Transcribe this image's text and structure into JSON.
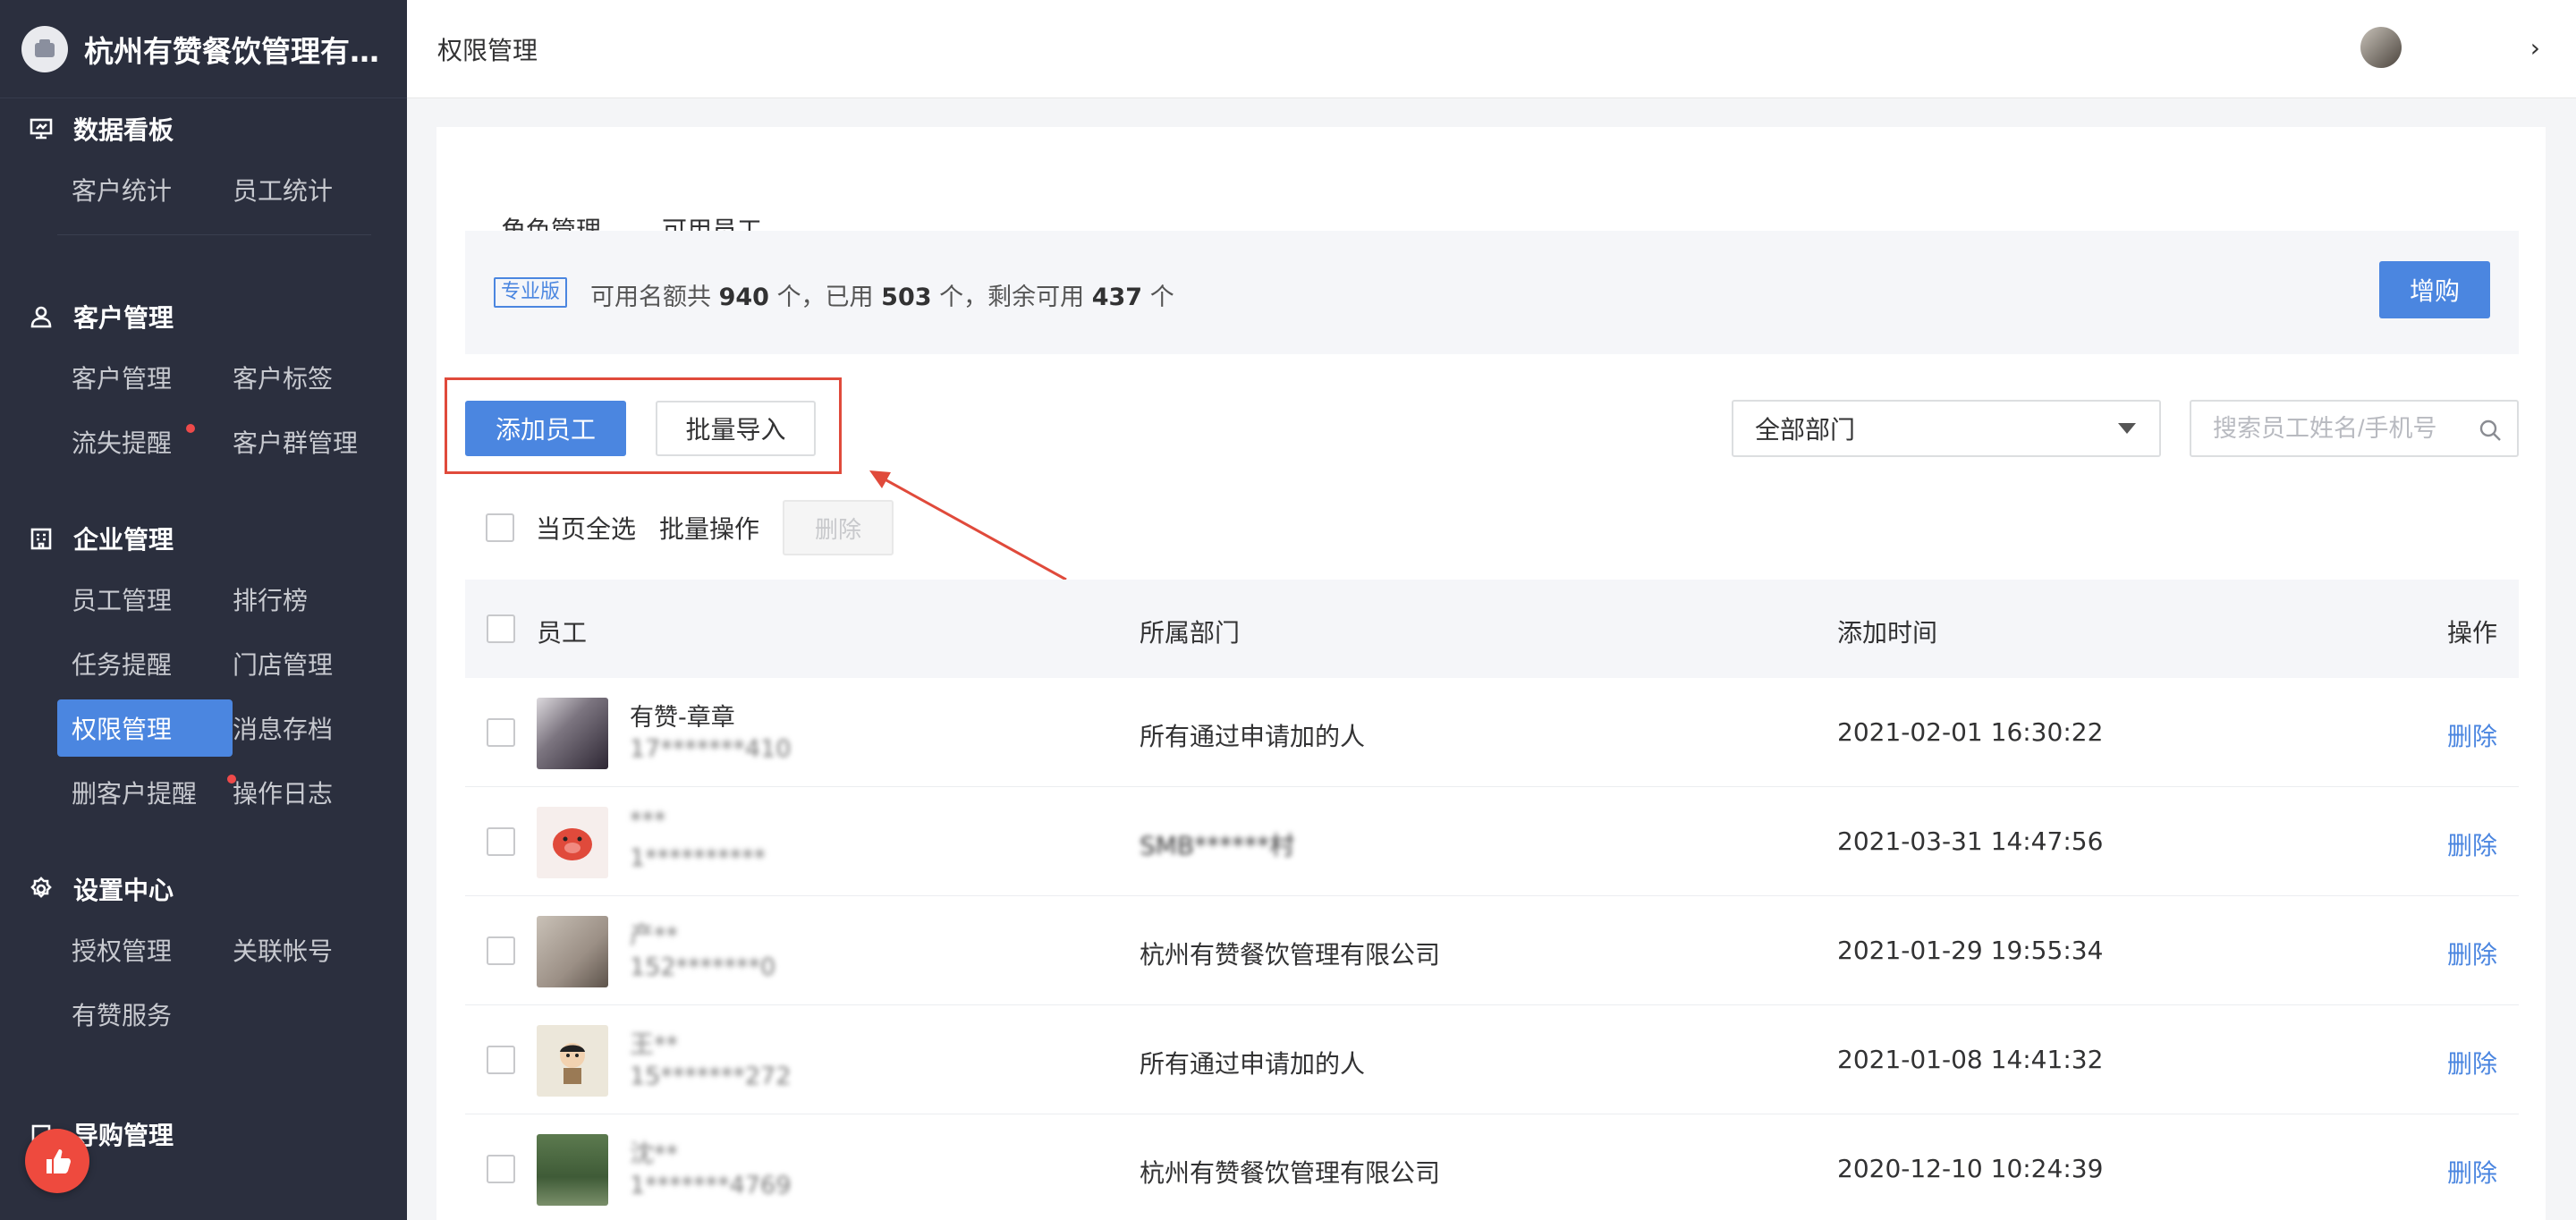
{
  "app": {
    "company_name": "杭州有赞餐饮管理有...",
    "breadcrumb": "权限管理"
  },
  "user": {
    "name": ""
  },
  "sidebar": {
    "groups": [
      {
        "title": "数据看板",
        "icon": "dashboard-icon",
        "rows": [
          [
            "客户统计",
            "员工统计"
          ]
        ]
      },
      {
        "title": "客户管理",
        "icon": "user-icon",
        "rows": [
          [
            "客户管理",
            "客户标签"
          ],
          [
            "流失提醒",
            "客户群管理"
          ]
        ]
      },
      {
        "title": "企业管理",
        "icon": "building-icon",
        "rows": [
          [
            "员工管理",
            "排行榜"
          ],
          [
            "任务提醒",
            "门店管理"
          ],
          [
            "权限管理",
            "消息存档"
          ],
          [
            "删客户提醒",
            "操作日志"
          ]
        ]
      },
      {
        "title": "设置中心",
        "icon": "gear-icon",
        "rows": [
          [
            "授权管理",
            "关联帐号"
          ],
          [
            "有赞服务"
          ]
        ]
      },
      {
        "title": "导购管理",
        "icon": "guide-icon",
        "rows": []
      }
    ],
    "active_item": "权限管理",
    "red_dot_items": [
      "流失提醒",
      "删客户提醒"
    ]
  },
  "tabs": [
    {
      "label": "角色管理",
      "active": false
    },
    {
      "label": "可用员工",
      "active": true
    }
  ],
  "quota": {
    "badge": "专业版",
    "prefix": "可用名额共",
    "total": "940",
    "unit1": "个，已用",
    "used": "503",
    "unit2": "个，剩余可用",
    "remaining": "437",
    "unit3": "个",
    "buy_label": "增购"
  },
  "actions": {
    "add_label": "添加员工",
    "import_label": "批量导入",
    "dept_select_value": "全部部门",
    "search_placeholder": "搜索员工姓名/手机号"
  },
  "bulk": {
    "select_page_label": "当页全选",
    "bulk_label": "批量操作",
    "delete_label": "删除"
  },
  "table": {
    "headers": {
      "employee": "员工",
      "department": "所属部门",
      "added_time": "添加时间",
      "operation": "操作"
    },
    "rows": [
      {
        "name": "有赞-章章",
        "phone": "17*******410",
        "department": "所有通过申请加的人",
        "time": "2021-02-01 16:30:22",
        "op": "删除"
      },
      {
        "name": "***",
        "phone": "1**********",
        "department": "SMB******村",
        "time": "2021-03-31 14:47:56",
        "op": "删除"
      },
      {
        "name": "产**",
        "phone": "152*******0",
        "department": "杭州有赞餐饮管理有限公司",
        "time": "2021-01-29 19:55:34",
        "op": "删除"
      },
      {
        "name": "王**",
        "phone": "15*******272",
        "department": "所有通过申请加的人",
        "time": "2021-01-08 14:41:32",
        "op": "删除"
      },
      {
        "name": "沈**",
        "phone": "1*******4769",
        "department": "杭州有赞餐饮管理有限公司",
        "time": "2020-12-10 10:24:39",
        "op": "删除"
      }
    ]
  },
  "colors": {
    "accent": "#4b86e0",
    "sidebar_bg": "#2b2f3e",
    "highlight": "#e04a3b",
    "dot": "#ee4a4a"
  }
}
